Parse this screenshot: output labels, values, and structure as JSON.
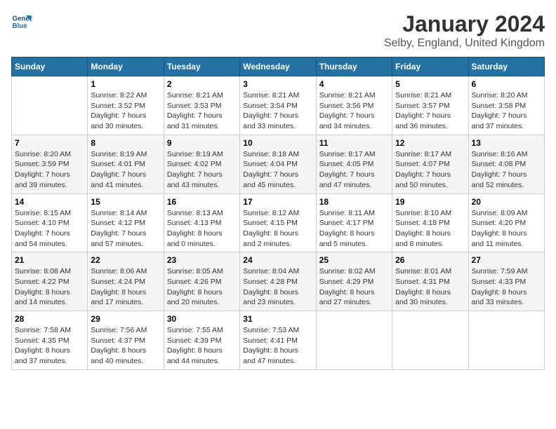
{
  "logo": {
    "line1": "General",
    "line2": "Blue"
  },
  "title": "January 2024",
  "subtitle": "Selby, England, United Kingdom",
  "days_of_week": [
    "Sunday",
    "Monday",
    "Tuesday",
    "Wednesday",
    "Thursday",
    "Friday",
    "Saturday"
  ],
  "weeks": [
    [
      {
        "day": "",
        "info": ""
      },
      {
        "day": "1",
        "info": "Sunrise: 8:22 AM\nSunset: 3:52 PM\nDaylight: 7 hours\nand 30 minutes."
      },
      {
        "day": "2",
        "info": "Sunrise: 8:21 AM\nSunset: 3:53 PM\nDaylight: 7 hours\nand 31 minutes."
      },
      {
        "day": "3",
        "info": "Sunrise: 8:21 AM\nSunset: 3:54 PM\nDaylight: 7 hours\nand 33 minutes."
      },
      {
        "day": "4",
        "info": "Sunrise: 8:21 AM\nSunset: 3:56 PM\nDaylight: 7 hours\nand 34 minutes."
      },
      {
        "day": "5",
        "info": "Sunrise: 8:21 AM\nSunset: 3:57 PM\nDaylight: 7 hours\nand 36 minutes."
      },
      {
        "day": "6",
        "info": "Sunrise: 8:20 AM\nSunset: 3:58 PM\nDaylight: 7 hours\nand 37 minutes."
      }
    ],
    [
      {
        "day": "7",
        "info": "Sunrise: 8:20 AM\nSunset: 3:59 PM\nDaylight: 7 hours\nand 39 minutes."
      },
      {
        "day": "8",
        "info": "Sunrise: 8:19 AM\nSunset: 4:01 PM\nDaylight: 7 hours\nand 41 minutes."
      },
      {
        "day": "9",
        "info": "Sunrise: 8:19 AM\nSunset: 4:02 PM\nDaylight: 7 hours\nand 43 minutes."
      },
      {
        "day": "10",
        "info": "Sunrise: 8:18 AM\nSunset: 4:04 PM\nDaylight: 7 hours\nand 45 minutes."
      },
      {
        "day": "11",
        "info": "Sunrise: 8:17 AM\nSunset: 4:05 PM\nDaylight: 7 hours\nand 47 minutes."
      },
      {
        "day": "12",
        "info": "Sunrise: 8:17 AM\nSunset: 4:07 PM\nDaylight: 7 hours\nand 50 minutes."
      },
      {
        "day": "13",
        "info": "Sunrise: 8:16 AM\nSunset: 4:08 PM\nDaylight: 7 hours\nand 52 minutes."
      }
    ],
    [
      {
        "day": "14",
        "info": "Sunrise: 8:15 AM\nSunset: 4:10 PM\nDaylight: 7 hours\nand 54 minutes."
      },
      {
        "day": "15",
        "info": "Sunrise: 8:14 AM\nSunset: 4:12 PM\nDaylight: 7 hours\nand 57 minutes."
      },
      {
        "day": "16",
        "info": "Sunrise: 8:13 AM\nSunset: 4:13 PM\nDaylight: 8 hours\nand 0 minutes."
      },
      {
        "day": "17",
        "info": "Sunrise: 8:12 AM\nSunset: 4:15 PM\nDaylight: 8 hours\nand 2 minutes."
      },
      {
        "day": "18",
        "info": "Sunrise: 8:11 AM\nSunset: 4:17 PM\nDaylight: 8 hours\nand 5 minutes."
      },
      {
        "day": "19",
        "info": "Sunrise: 8:10 AM\nSunset: 4:18 PM\nDaylight: 8 hours\nand 8 minutes."
      },
      {
        "day": "20",
        "info": "Sunrise: 8:09 AM\nSunset: 4:20 PM\nDaylight: 8 hours\nand 11 minutes."
      }
    ],
    [
      {
        "day": "21",
        "info": "Sunrise: 8:08 AM\nSunset: 4:22 PM\nDaylight: 8 hours\nand 14 minutes."
      },
      {
        "day": "22",
        "info": "Sunrise: 8:06 AM\nSunset: 4:24 PM\nDaylight: 8 hours\nand 17 minutes."
      },
      {
        "day": "23",
        "info": "Sunrise: 8:05 AM\nSunset: 4:26 PM\nDaylight: 8 hours\nand 20 minutes."
      },
      {
        "day": "24",
        "info": "Sunrise: 8:04 AM\nSunset: 4:28 PM\nDaylight: 8 hours\nand 23 minutes."
      },
      {
        "day": "25",
        "info": "Sunrise: 8:02 AM\nSunset: 4:29 PM\nDaylight: 8 hours\nand 27 minutes."
      },
      {
        "day": "26",
        "info": "Sunrise: 8:01 AM\nSunset: 4:31 PM\nDaylight: 8 hours\nand 30 minutes."
      },
      {
        "day": "27",
        "info": "Sunrise: 7:59 AM\nSunset: 4:33 PM\nDaylight: 8 hours\nand 33 minutes."
      }
    ],
    [
      {
        "day": "28",
        "info": "Sunrise: 7:58 AM\nSunset: 4:35 PM\nDaylight: 8 hours\nand 37 minutes."
      },
      {
        "day": "29",
        "info": "Sunrise: 7:56 AM\nSunset: 4:37 PM\nDaylight: 8 hours\nand 40 minutes."
      },
      {
        "day": "30",
        "info": "Sunrise: 7:55 AM\nSunset: 4:39 PM\nDaylight: 8 hours\nand 44 minutes."
      },
      {
        "day": "31",
        "info": "Sunrise: 7:53 AM\nSunset: 4:41 PM\nDaylight: 8 hours\nand 47 minutes."
      },
      {
        "day": "",
        "info": ""
      },
      {
        "day": "",
        "info": ""
      },
      {
        "day": "",
        "info": ""
      }
    ]
  ]
}
